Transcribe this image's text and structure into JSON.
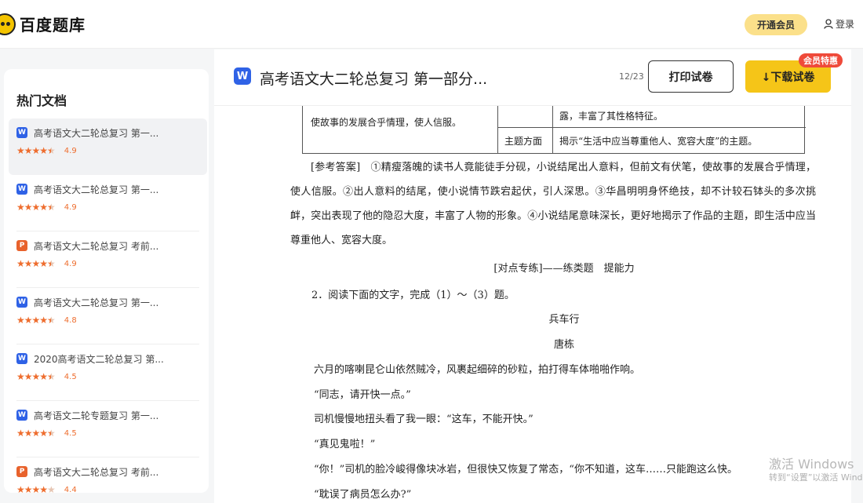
{
  "header": {
    "logo_text": "百度题库",
    "vip_button": "开通会员",
    "login_label": "登录"
  },
  "sidebar": {
    "title": "热门文档",
    "items": [
      {
        "badge": "W",
        "title": "高考语文大二轮总复习 第一...",
        "rating": 4.9,
        "score": "4.9"
      },
      {
        "badge": "W",
        "title": "高考语文大二轮总复习 第一...",
        "rating": 4.9,
        "score": "4.9"
      },
      {
        "badge": "P",
        "title": "高考语文大二轮总复习 考前...",
        "rating": 4.9,
        "score": "4.9"
      },
      {
        "badge": "W",
        "title": "高考语文大二轮总复习 第一...",
        "rating": 4.8,
        "score": "4.8"
      },
      {
        "badge": "W",
        "title": "2020高考语文二轮总复习 第...",
        "rating": 4.5,
        "score": "4.5"
      },
      {
        "badge": "W",
        "title": "高考语文二轮专题复习 第一...",
        "rating": 4.5,
        "score": "4.5"
      },
      {
        "badge": "P",
        "title": "高考语文大二轮总复习 考前...",
        "rating": 4.4,
        "score": "4.4"
      }
    ]
  },
  "docbar": {
    "badge": "W",
    "title": "高考语文大二轮总复习 第一部分...",
    "page_count": "12/23",
    "print_button": "打印试卷",
    "download_button": "↓下载试卷",
    "promo_badge": "会员特惠"
  },
  "document": {
    "table": {
      "left_cell": "使故事的发展合乎情理，使人信服。",
      "right_cell_1": "露，丰富了其性格特征。",
      "topic_label": "主题方面",
      "right_cell_2": "揭示“生活中应当尊重他人、宽容大度”的主题。"
    },
    "answer_para": "[参考答案]　①精瘦落魄的读书人竟能徒手分砚，小说结尾出人意料，但前文有伏笔，使故事的发展合乎情理，使人信服。②出人意料的结尾，使小说情节跌宕起伏，引人深思。③华昌明明身怀绝技，却不计较石钵头的多次挑衅，突出表现了他的隐忍大度，丰富了人物的形象。④小说结尾意味深长，更好地揭示了作品的主题，即生活中应当尊重他人、宽容大度。",
    "section_heading": "[对点专练]——练类题　提能力",
    "question": "2．阅读下面的文字，完成（1）～（3）题。",
    "story_title": "兵车行",
    "author": "唐栋",
    "lines": [
      "六月的喀喇昆仑山依然贼冷，风裹起细碎的砂粒，拍打得车体啪啪作响。",
      "“同志，请开快一点。”",
      "司机慢慢地扭头看了我一眼：“这车，不能开快。”",
      "“真见鬼啦！”",
      "“你！”司机的脸冷峻得像块冰岩，但很快又恢复了常态，“你不知道，这车……只能跑这么快。",
      "“耽误了病员怎么办?”"
    ]
  },
  "os_watermark": {
    "line1": "激活 Windows",
    "line2": "转到“设置”以激活 Windows"
  },
  "colors": {
    "accent_yellow": "#f5c518",
    "vip_yellow": "#fbe08a",
    "star_orange": "#ee6d2e",
    "word_blue": "#2f62e6",
    "ppt_orange": "#e8622c",
    "promo_red": "#ef4a3a"
  }
}
